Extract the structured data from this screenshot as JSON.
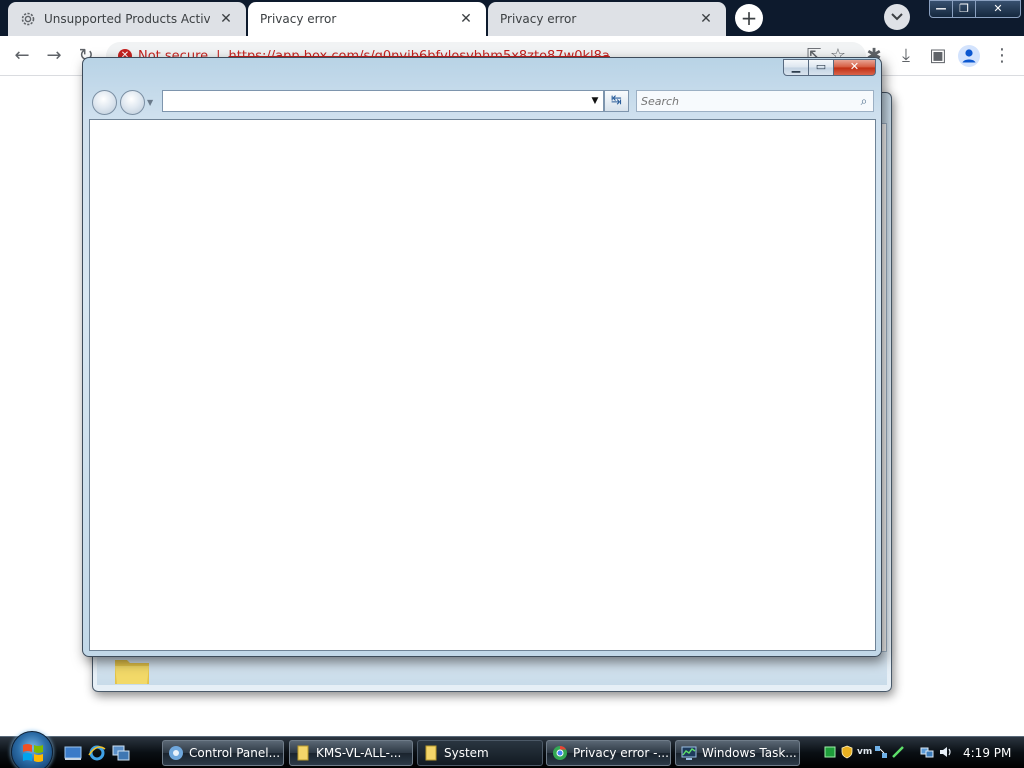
{
  "browser": {
    "tabs": [
      {
        "title": "Unsupported Products Activatio",
        "icon": "gear-icon",
        "close": "✕",
        "active": false
      },
      {
        "title": "Privacy error",
        "close": "✕",
        "active": true
      },
      {
        "title": "Privacy error",
        "close": "✕",
        "active": false
      }
    ],
    "new_tab_label": "+",
    "window_controls": {
      "minimize": "—",
      "maximize": "❐",
      "close": "✕"
    },
    "toolbar": {
      "back": "←",
      "forward": "→",
      "reload": "↻",
      "security_label": "Not secure",
      "separator": "|",
      "url": "https://app.box.com/s/g0nvib6bfvlosvbhm5x8zto87w0kl8a",
      "share": "⇱",
      "bookmark": "☆",
      "extensions": "✱",
      "download": "⤓",
      "side_panel": "▣",
      "menu": "⋮"
    }
  },
  "explorer": {
    "controls": {
      "minimize": "▁",
      "maximize": "▭",
      "close": "✕"
    },
    "address_value": "",
    "address_dropdown": "▼",
    "refresh": "↹",
    "search_placeholder": "Search",
    "search_icon": "⌕"
  },
  "taskbar": {
    "items": [
      {
        "label": "Control Panel...",
        "icon": "control-panel-icon"
      },
      {
        "label": "KMS-VL-ALL-...",
        "icon": "folder-icon"
      },
      {
        "label": "System",
        "icon": "folder-icon"
      },
      {
        "label": "Privacy error -...",
        "icon": "chrome-icon"
      },
      {
        "label": "Windows Task...",
        "icon": "task-manager-icon"
      }
    ],
    "clock": "4:19 PM"
  },
  "colors": {
    "chrome_tab_strip": "#0d1a2d",
    "not_secure_red": "#c5221f",
    "aero_glass": "#c2d8e8",
    "aero_close": "#c8402a",
    "taskbar": "#0a0f14"
  }
}
